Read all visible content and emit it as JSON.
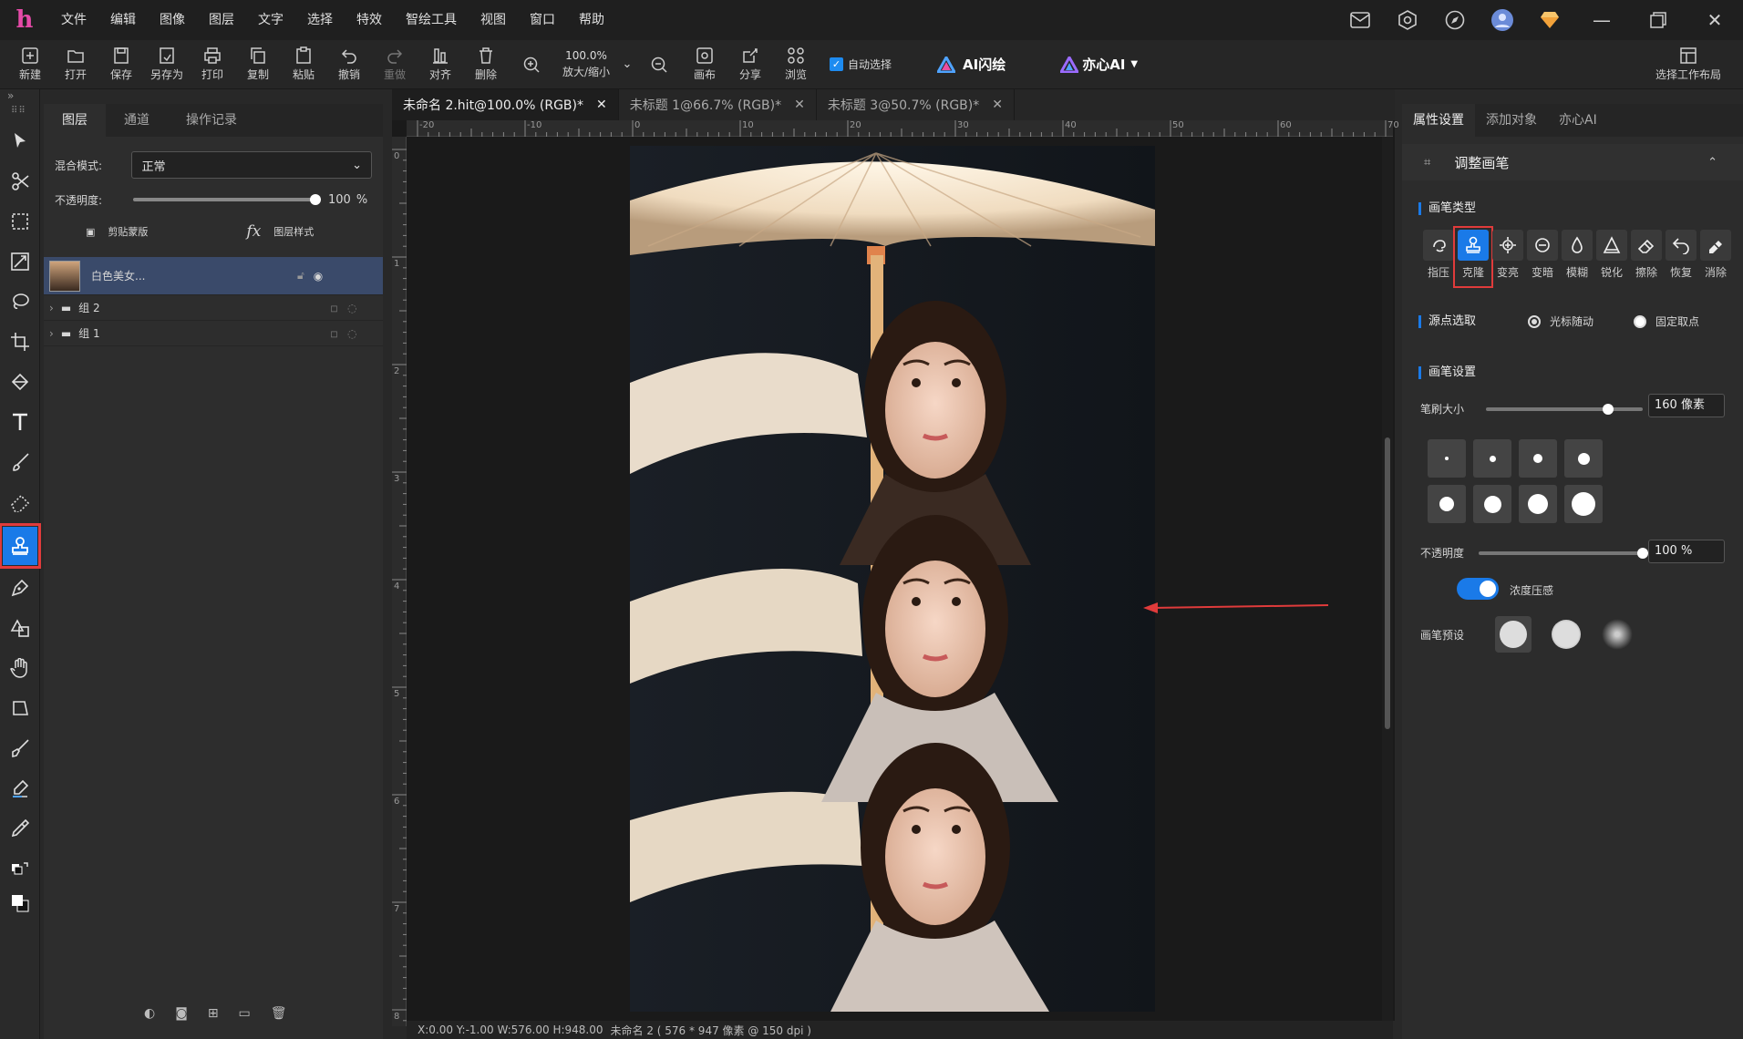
{
  "menu": [
    "文件",
    "编辑",
    "图像",
    "图层",
    "文字",
    "选择",
    "特效",
    "智绘工具",
    "视图",
    "窗口",
    "帮助"
  ],
  "toolbar": {
    "new": "新建",
    "open": "打开",
    "save": "保存",
    "saveas": "另存为",
    "print": "打印",
    "copy": "复制",
    "paste": "粘贴",
    "undo": "撤销",
    "redo": "重做",
    "align": "对齐",
    "delete": "删除",
    "zoom_value": "100.0%",
    "zoom_label": "放大/缩小",
    "canvas": "画布",
    "share": "分享",
    "browse": "浏览",
    "auto_select": "自动选择",
    "ai_flash": "AI闪绘",
    "yixin_ai": "亦心AI",
    "workspace": "选择工作布局"
  },
  "layers_panel": {
    "tabs": [
      "图层",
      "通道",
      "操作记录"
    ],
    "blend_label": "混合模式:",
    "blend_value": "正常",
    "opacity_label": "不透明度:",
    "opacity_value": "100",
    "opacity_unit": "%",
    "opacity_level": 1.0,
    "clip_mask": "剪贴蒙版",
    "layer_style": "图层样式",
    "layers": [
      {
        "name": "白色美女..."
      },
      {
        "name": "组 2"
      },
      {
        "name": "组 1"
      }
    ]
  },
  "doc_tabs": [
    {
      "label": "未命名 2.hit@100.0% (RGB)*",
      "active": true
    },
    {
      "label": "未标题 1@66.7% (RGB)*",
      "active": false
    },
    {
      "label": "未标题 3@50.7% (RGB)*",
      "active": false
    }
  ],
  "ruler_h": [
    "-20",
    "-10",
    "0",
    "10",
    "20",
    "30",
    "40",
    "50",
    "60",
    "70"
  ],
  "ruler_v": [
    "0",
    "1",
    "2",
    "3",
    "4",
    "5",
    "6",
    "7",
    "8"
  ],
  "status": "X:0.00 Y:-1.00 W:576.00 H:948.00 ",
  "status_doc": "未命名 2 ( 576 * 947 像素 @ 150 dpi )",
  "right_panel": {
    "tabs": [
      "属性设置",
      "添加对象",
      "亦心AI"
    ],
    "header": "调整画笔",
    "brush_type_title": "画笔类型",
    "brush_types": [
      "指压",
      "克隆",
      "变亮",
      "变暗",
      "模糊",
      "锐化",
      "擦除",
      "恢复",
      "消除"
    ],
    "active_brush": "克隆",
    "source_title": "源点选取",
    "source_opt1": "光标随动",
    "source_opt2": "固定取点",
    "brush_settings_title": "画笔设置",
    "brush_size_label": "笔刷大小",
    "brush_size_value": "160 像素",
    "brush_size_level": 0.78,
    "opacity_label": "不透明度",
    "opacity_value": "100 %",
    "opacity_level": 1.0,
    "pressure_label": "浓度压感",
    "preset_label": "画笔预设"
  },
  "colors": {
    "accent": "#1a7ae8",
    "highlight": "#e03b3b",
    "logo": "#e64aa8"
  }
}
